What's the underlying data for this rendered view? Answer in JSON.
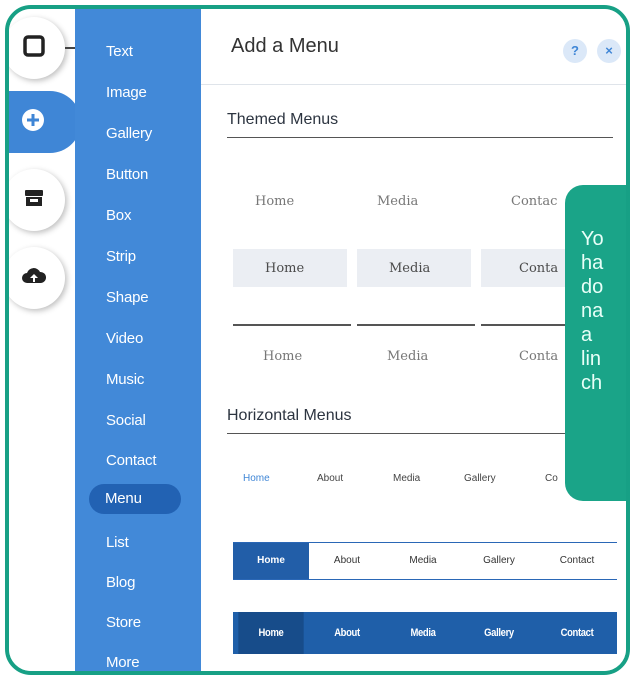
{
  "panel": {
    "title": "Add a Menu",
    "help_label": "?",
    "close_label": "×"
  },
  "categories": [
    {
      "label": "Text"
    },
    {
      "label": "Image"
    },
    {
      "label": "Gallery"
    },
    {
      "label": "Button"
    },
    {
      "label": "Box"
    },
    {
      "label": "Strip"
    },
    {
      "label": "Shape"
    },
    {
      "label": "Video"
    },
    {
      "label": "Music"
    },
    {
      "label": "Social"
    },
    {
      "label": "Contact"
    },
    {
      "label": "Menu",
      "selected": true
    },
    {
      "label": "List"
    },
    {
      "label": "Blog"
    },
    {
      "label": "Store"
    },
    {
      "label": "More"
    }
  ],
  "rail_icons": [
    "square-icon",
    "plus-icon",
    "store-icon",
    "cloud-upload-icon"
  ],
  "themed": {
    "section_title": "Themed Menus",
    "row1": [
      "Home",
      "Media",
      "Contac"
    ],
    "row2": [
      "Home",
      "Media",
      "Conta"
    ],
    "row3": [
      "Home",
      "Media",
      "Conta"
    ]
  },
  "horizontal": {
    "section_title": "Horizontal Menus",
    "row1": [
      "Home",
      "About",
      "Media",
      "Gallery",
      "Co"
    ],
    "row2": [
      "Home",
      "About",
      "Media",
      "Gallery",
      "Contact"
    ],
    "row3": [
      "Home",
      "About",
      "Media",
      "Gallery",
      "Contact"
    ]
  },
  "callout": {
    "lines": [
      "Yo",
      "ha",
      "do",
      "na",
      "a",
      "lin",
      "ch"
    ]
  },
  "colors": {
    "frame": "#17a085",
    "category_bg": "#4289d8",
    "selected_bg": "#2262b3",
    "callout": "#1aa488",
    "menu_dark": "#1f5fa9"
  }
}
